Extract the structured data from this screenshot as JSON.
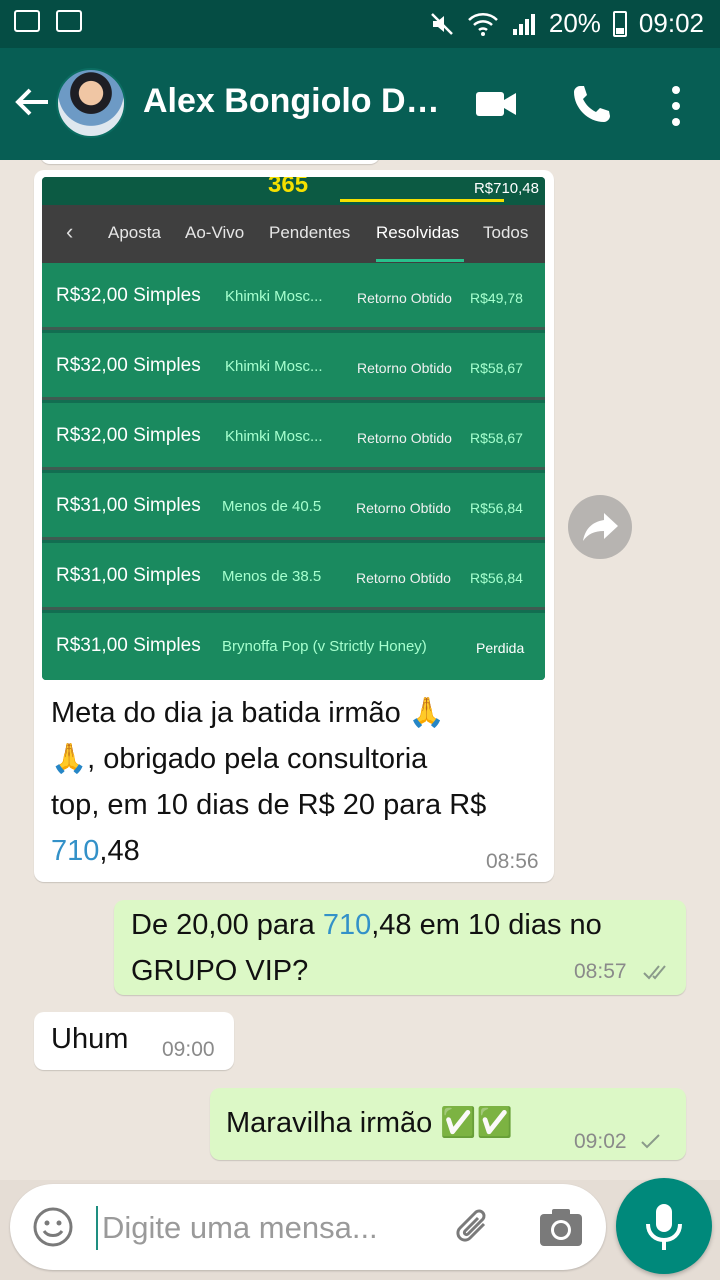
{
  "status_bar": {
    "battery": "20%",
    "time": "09:02"
  },
  "header": {
    "contact_name": "Alex Bongiolo Do..."
  },
  "shared_screenshot": {
    "logo": "365",
    "balance": "R$710,48",
    "tabs": [
      "Aposta",
      "Ao-Vivo",
      "Pendentes",
      "Resolvidas",
      "Todos"
    ],
    "active_tab": "Resolvidas",
    "bets": [
      {
        "stake": "R$32,00 Simples",
        "event": "Khimki Mosc...",
        "result_label": "Retorno Obtido",
        "result_value": "R$49,78"
      },
      {
        "stake": "R$32,00 Simples",
        "event": "Khimki Mosc...",
        "result_label": "Retorno Obtido",
        "result_value": "R$58,67"
      },
      {
        "stake": "R$32,00 Simples",
        "event": "Khimki Mosc...",
        "result_label": "Retorno Obtido",
        "result_value": "R$58,67"
      },
      {
        "stake": "R$31,00 Simples",
        "event": "Menos de 40.5",
        "result_label": "Retorno Obtido",
        "result_value": "R$56,84"
      },
      {
        "stake": "R$31,00 Simples",
        "event": "Menos de 38.5",
        "result_label": "Retorno Obtido",
        "result_value": "R$56,84"
      },
      {
        "stake": "R$31,00 Simples",
        "event": "Brynoffa Pop (v Strictly Honey)",
        "result_label": "",
        "result_value": "Perdida"
      }
    ]
  },
  "messages": [
    {
      "direction": "in",
      "line1": "Meta do dia ja batida irmão 🙏",
      "line2": "🙏, obrigado pela consultoria",
      "line3": "top, em 10 dias de R$ 20 para R$",
      "line4_link": "710",
      "line4_rest": ",48",
      "time": "08:56"
    },
    {
      "direction": "out",
      "prefix": "De 20,00 para ",
      "link": "710",
      "suffix": ",48 em 10 dias no",
      "line2": "GRUPO VIP?",
      "time": "08:57",
      "status": "delivered"
    },
    {
      "direction": "in",
      "text": "Uhum",
      "time": "09:00"
    },
    {
      "direction": "out",
      "text": "Maravilha irmão ✅✅",
      "time": "09:02",
      "status": "sent"
    }
  ],
  "composer": {
    "placeholder": "Digite uma mensa..."
  },
  "icons": {
    "back": "arrow-left-icon",
    "video": "video-camera-icon",
    "call": "phone-icon",
    "menu": "more-vert-icon",
    "forward": "forward-icon",
    "emoji": "emoji-icon",
    "attach": "paperclip-icon",
    "camera": "camera-icon",
    "mic": "mic-icon"
  },
  "colors": {
    "header": "#075e54",
    "status_bar": "#054d44",
    "outgoing_bubble": "#dcf8c6",
    "incoming_bubble": "#ffffff",
    "link": "#3391c8",
    "fab": "#00897b"
  }
}
